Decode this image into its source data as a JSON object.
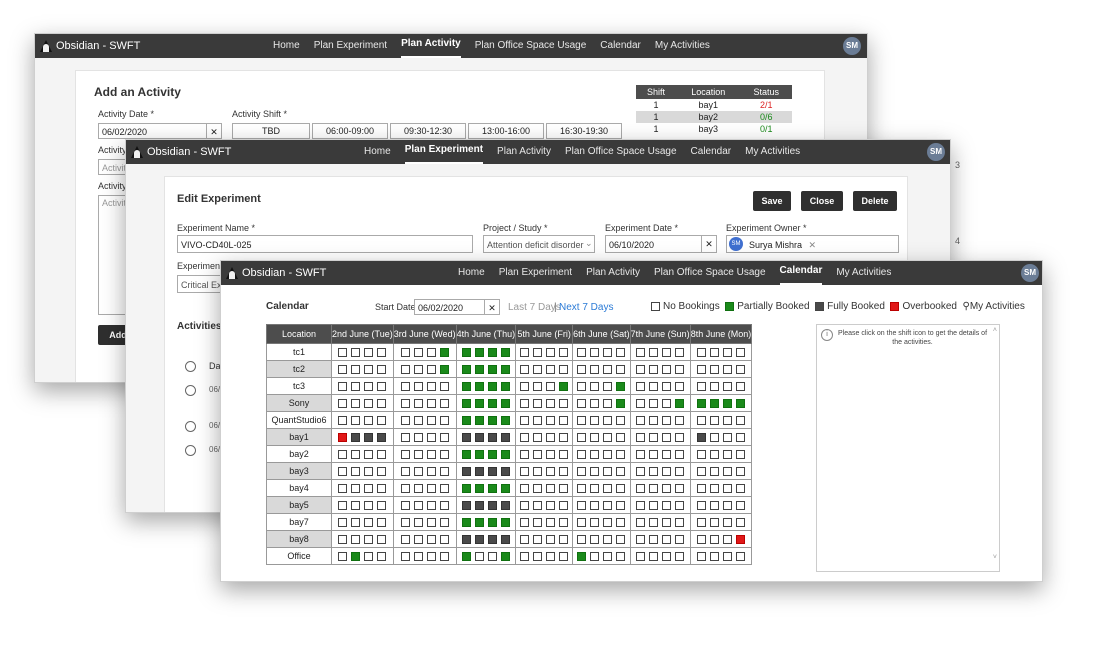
{
  "app": {
    "brand": "Obsidian - SWFT",
    "avatar": "SM"
  },
  "nav": [
    "Home",
    "Plan Experiment",
    "Plan Activity",
    "Plan Office Space Usage",
    "Calendar",
    "My Activities"
  ],
  "activity": {
    "title": "Add an Activity",
    "date_label": "Activity Date *",
    "date_value": "06/02/2020",
    "shift_label": "Activity Shift *",
    "shifts": [
      "TBD",
      "06:00-09:00",
      "09:30-12:30",
      "13:00-16:00",
      "16:30-19:30"
    ],
    "field3_label": "Activity I",
    "field3_placeholder": "Activity",
    "field4_label": "Activity I",
    "field4_placeholder": "Activity",
    "add_button": "Add",
    "shift_table": {
      "headers": [
        "Shift",
        "Location",
        "Status"
      ],
      "rows": [
        [
          "1",
          "bay1",
          "2/1"
        ],
        [
          "1",
          "bay2",
          "0/6"
        ],
        [
          "1",
          "bay3",
          "0/1"
        ]
      ],
      "row_numbers": [
        "3",
        "4"
      ]
    }
  },
  "experiment": {
    "title": "Edit Experiment",
    "save": "Save",
    "close": "Close",
    "delete": "Delete",
    "name_label": "Experiment Name *",
    "name_value": "VIVO-CD40L-025",
    "project_label": "Project / Study *",
    "project_value": "Attention deficit disorder",
    "date_label": "Experiment Date *",
    "date_value": "06/10/2020",
    "owner_label": "Experiment Owner *",
    "owner_value": "Surya Mishra",
    "owner_initials": "SM",
    "desc_label": "Experiment D",
    "desc_value": "Critical Expe",
    "activities_title": "Activities",
    "activities_col": "Dat",
    "activity_rows": [
      "06/",
      "06/",
      "06/"
    ]
  },
  "calendar": {
    "title": "Calendar",
    "start_label": "Start Date",
    "start_value": "06/02/2020",
    "last7": "Last 7 Days",
    "sep": "|",
    "next7": "Next 7 Days",
    "legend": [
      "No Bookings",
      "Partially Booked",
      "Fully Booked",
      "Overbooked",
      "My Activities"
    ],
    "info": "Please click on the shift icon to get the details of the activities.",
    "location_header": "Location",
    "days": [
      "2nd June (Tue)",
      "3rd June (Wed)",
      "4th June (Thu)",
      "5th June (Fri)",
      "6th June (Sat)",
      "7th June (Sun)",
      "8th June (Mon)"
    ],
    "rows": [
      {
        "loc": "tc1",
        "cells": [
          "NNNN",
          "NNNP",
          "PPPP",
          "NNNN",
          "NNNN",
          "NNNN",
          "NNNN"
        ]
      },
      {
        "loc": "tc2",
        "cells": [
          "NNNN",
          "NNNP",
          "PPPP",
          "NNNN",
          "NNNN",
          "NNNN",
          "NNNN"
        ]
      },
      {
        "loc": "tc3",
        "cells": [
          "NNNN",
          "NNNN",
          "PPPP",
          "NNNP",
          "NNNP",
          "NNNN",
          "NNNN"
        ]
      },
      {
        "loc": "Sony",
        "cells": [
          "NNNN",
          "NNNN",
          "PPPP",
          "NNNN",
          "NNNP",
          "NNNP",
          "PPPP"
        ]
      },
      {
        "loc": "QuantStudio6",
        "cells": [
          "NNNN",
          "NNNN",
          "PPPP",
          "NNNN",
          "NNNN",
          "NNNN",
          "NNNN"
        ]
      },
      {
        "loc": "bay1",
        "cells": [
          "OFFF",
          "NNNN",
          "FFFF",
          "NNNN",
          "NNNN",
          "NNNN",
          "FNNN"
        ]
      },
      {
        "loc": "bay2",
        "cells": [
          "NNNN",
          "NNNN",
          "PPPP",
          "NNNN",
          "NNNN",
          "NNNN",
          "NNNN"
        ]
      },
      {
        "loc": "bay3",
        "cells": [
          "NNNN",
          "NNNN",
          "FFFF",
          "NNNN",
          "NNNN",
          "NNNN",
          "NNNN"
        ]
      },
      {
        "loc": "bay4",
        "cells": [
          "NNNN",
          "NNNN",
          "PPPP",
          "NNNN",
          "NNNN",
          "NNNN",
          "NNNN"
        ]
      },
      {
        "loc": "bay5",
        "cells": [
          "NNNN",
          "NNNN",
          "FFFF",
          "NNNN",
          "NNNN",
          "NNNN",
          "NNNN"
        ]
      },
      {
        "loc": "bay7",
        "cells": [
          "NNNN",
          "NNNN",
          "PPPP",
          "NNNN",
          "NNNN",
          "NNNN",
          "NNNN"
        ]
      },
      {
        "loc": "bay8",
        "cells": [
          "NNNN",
          "NNNN",
          "FFFF",
          "NNNN",
          "NNNN",
          "NNNN",
          "NNNO"
        ]
      },
      {
        "loc": "Office",
        "cells": [
          "NPNN",
          "NNNN",
          "PNNP",
          "NNNN",
          "PNNN",
          "NNNN",
          "NNNN"
        ]
      }
    ]
  },
  "colors": {
    "partial": "#1a8a1a",
    "full": "#4a4a4a",
    "over": "#e11818",
    "nav": "#3a3a3a"
  }
}
